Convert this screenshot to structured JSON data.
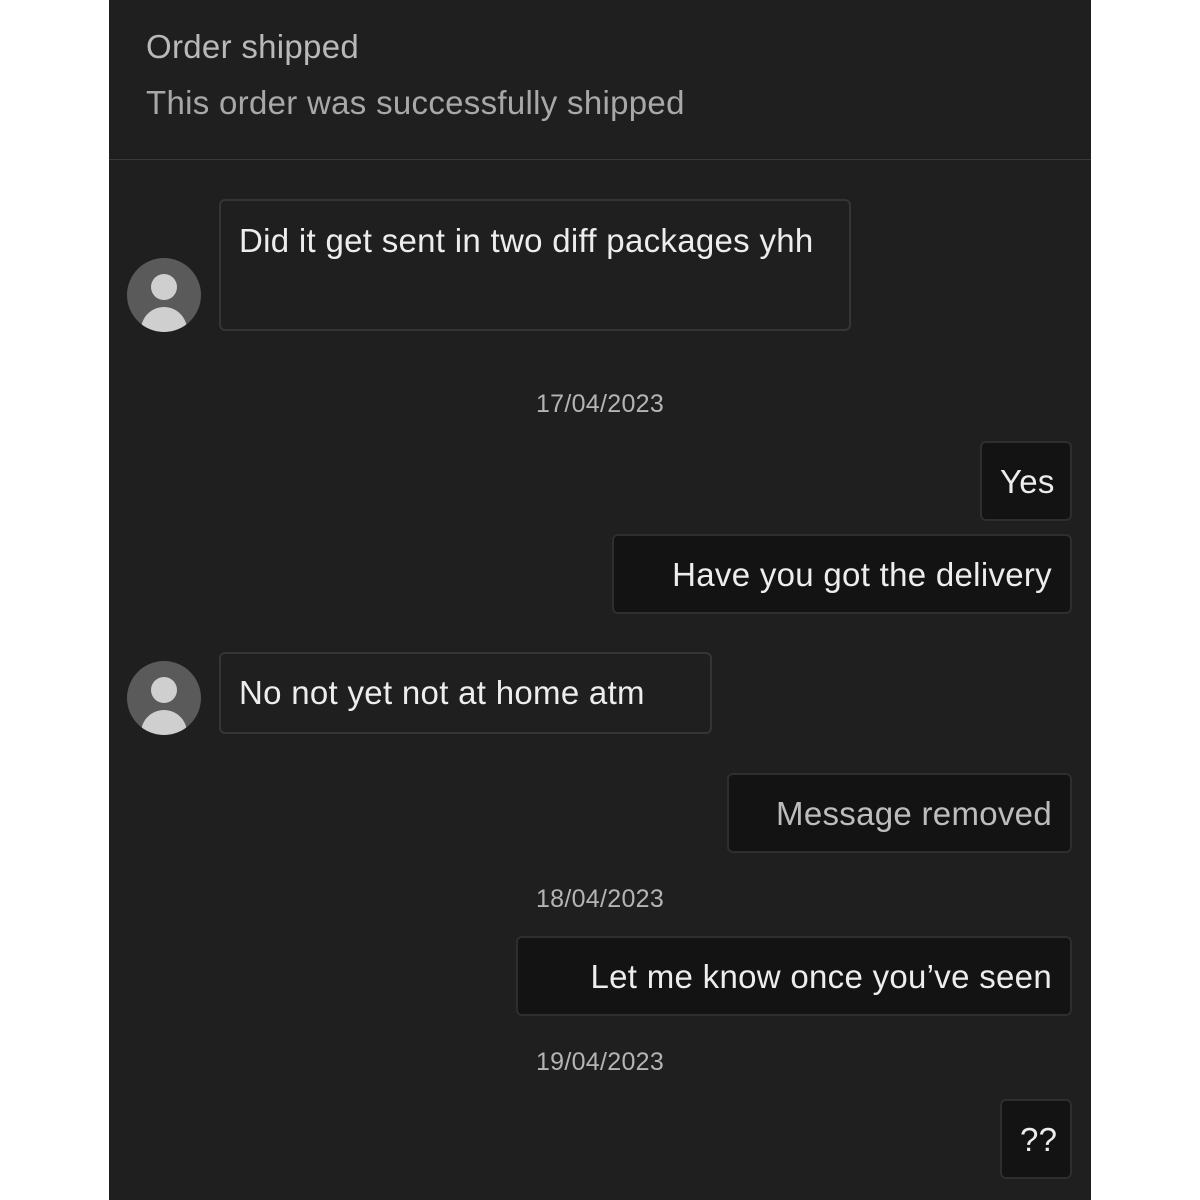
{
  "header": {
    "title": "Order shipped",
    "subtitle": "This order was successfully shipped"
  },
  "messages": [
    {
      "side": "in",
      "text": "Did it get sent in two diff packages yhh"
    },
    {
      "side": "date",
      "text": "17/04/2023"
    },
    {
      "side": "out",
      "text": "Yes"
    },
    {
      "side": "out",
      "text": "Have you got the delivery"
    },
    {
      "side": "in",
      "text": "No not yet not at home atm"
    },
    {
      "side": "out",
      "text": "Message removed"
    },
    {
      "side": "date",
      "text": "18/04/2023"
    },
    {
      "side": "out",
      "text": "Let me know once you’ve seen"
    },
    {
      "side": "date",
      "text": "19/04/2023"
    },
    {
      "side": "out",
      "text": "??"
    }
  ],
  "icons": {
    "avatar": "user-avatar-icon"
  },
  "colors": {
    "background": "#1f1f1f",
    "outgoing_bubble": "#131313",
    "incoming_border": "#353535",
    "text": "#ededed"
  }
}
